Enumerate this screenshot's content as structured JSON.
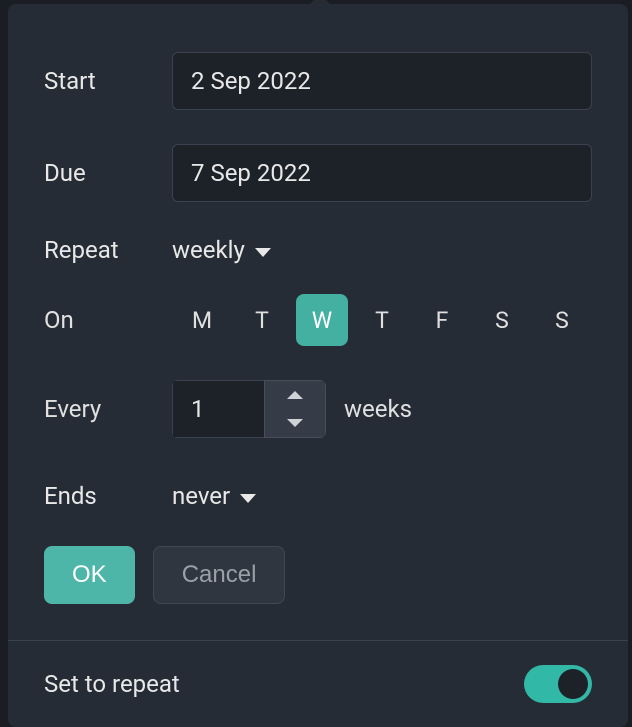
{
  "start": {
    "label": "Start",
    "value": "2 Sep 2022"
  },
  "due": {
    "label": "Due",
    "value": "7 Sep 2022"
  },
  "repeat": {
    "label": "Repeat",
    "value": "weekly"
  },
  "on": {
    "label": "On",
    "days": [
      "M",
      "T",
      "W",
      "T",
      "F",
      "S",
      "S"
    ],
    "selected_index": 2
  },
  "every": {
    "label": "Every",
    "value": "1",
    "unit": "weeks"
  },
  "ends": {
    "label": "Ends",
    "value": "never"
  },
  "buttons": {
    "ok": "OK",
    "cancel": "Cancel"
  },
  "footer": {
    "label": "Set to repeat",
    "toggle_on": true
  }
}
